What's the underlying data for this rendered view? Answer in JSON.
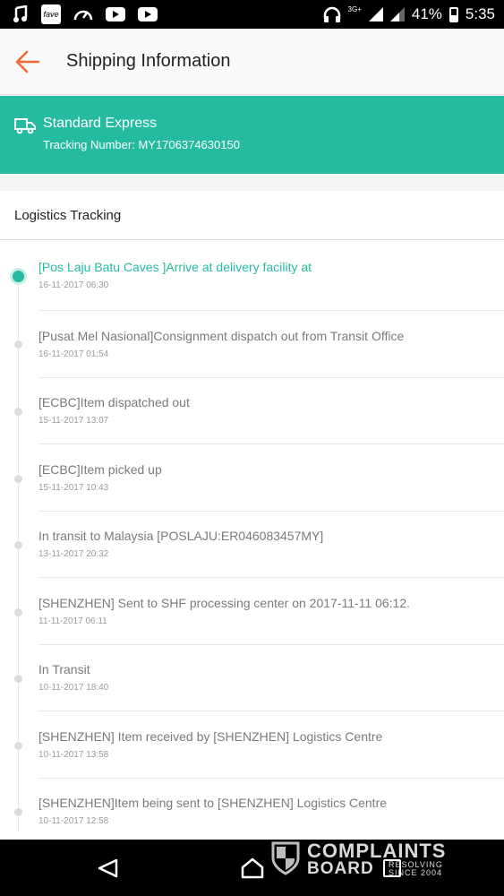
{
  "status_bar": {
    "network": "3G+",
    "battery": "41%",
    "time": "5:35",
    "left_icons": [
      "music-icon",
      "fave-app-icon",
      "speedometer-icon",
      "youtube-icon",
      "youtube-icon"
    ],
    "right_icons": [
      "headphones-icon",
      "signal-icon",
      "signal-icon",
      "battery-icon"
    ],
    "fave_label": "fave"
  },
  "app_bar": {
    "title": "Shipping Information",
    "back_icon": "back-arrow-icon",
    "accent": "#f06a35"
  },
  "shipping": {
    "carrier": "Standard Express",
    "tracking_number": "Tracking Number: MY1706374630150",
    "icon": "truck-icon",
    "color": "#25bba0"
  },
  "tracking": {
    "section_title": "Logistics Tracking",
    "events": [
      {
        "description": "[Pos Laju Batu Caves ]Arrive at delivery facility at",
        "time": "16-11-2017 06:30",
        "active": true
      },
      {
        "description": "[Pusat Mel Nasional]Consignment dispatch out from Transit Office",
        "time": "16-11-2017 01:54"
      },
      {
        "description": "[ECBC]Item dispatched out",
        "time": "15-11-2017 13:07"
      },
      {
        "description": "[ECBC]Item picked up",
        "time": "15-11-2017 10:43"
      },
      {
        "description": "In transit to Malaysia [POSLAJU:ER046083457MY]",
        "time": "13-11-2017 20:32"
      },
      {
        "description": "[SHENZHEN] Sent to SHF processing center on 2017-11-11 06:12.",
        "time": "11-11-2017 06:11"
      },
      {
        "description": "In Transit",
        "time": "10-11-2017 18:40"
      },
      {
        "description": "[SHENZHEN] Item received by [SHENZHEN] Logistics Centre",
        "time": "10-11-2017 13:58"
      },
      {
        "description": "[SHENZHEN]Item being sent to [SHENZHEN] Logistics Centre",
        "time": "10-11-2017 12:58"
      }
    ]
  },
  "nav_bar": {
    "icons": [
      "nav-back-icon",
      "nav-home-icon",
      "nav-recent-apps-icon"
    ]
  },
  "watermark": {
    "line1": "COMPLAINTS",
    "line2": "BOARD",
    "tagline1": "RESOLVING",
    "tagline2": "SINCE 2004"
  }
}
